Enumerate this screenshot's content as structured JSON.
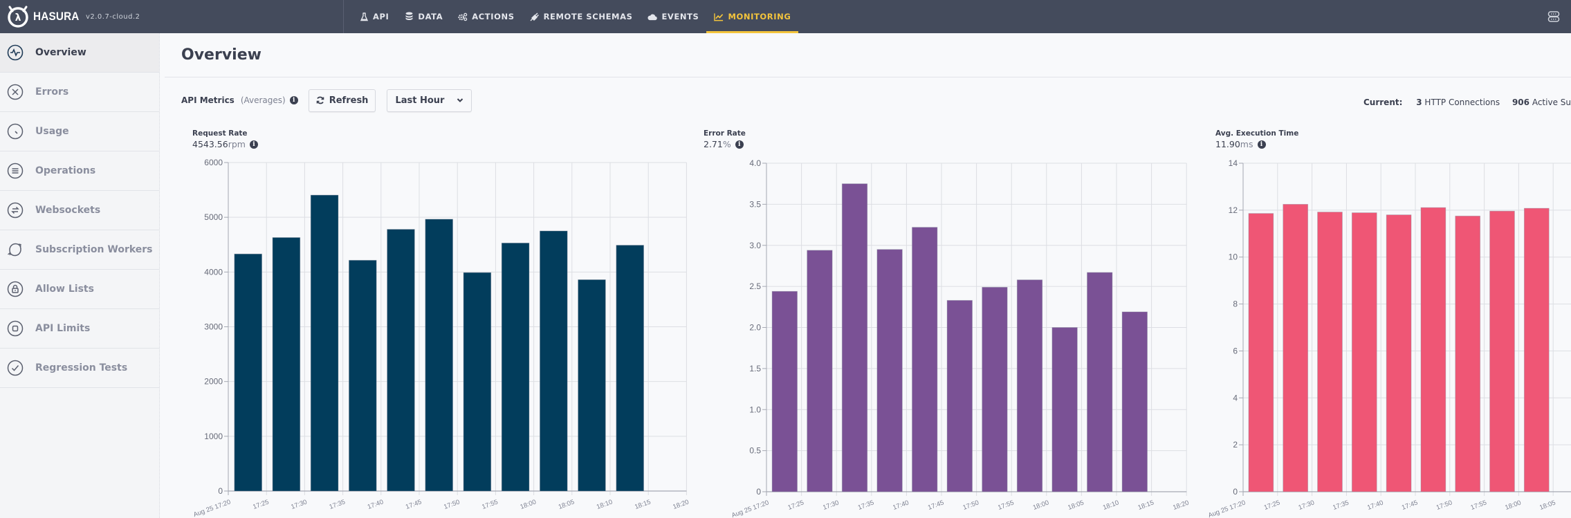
{
  "topbar": {
    "brand": "HASURA",
    "version": "v2.0.7-cloud.2",
    "nav": [
      {
        "label": "API",
        "icon": "flask-icon"
      },
      {
        "label": "DATA",
        "icon": "database-icon"
      },
      {
        "label": "ACTIONS",
        "icon": "cogs-icon"
      },
      {
        "label": "REMOTE SCHEMAS",
        "icon": "plug-icon"
      },
      {
        "label": "EVENTS",
        "icon": "cloud-icon"
      },
      {
        "label": "MONITORING",
        "icon": "line-chart-icon",
        "active": true
      }
    ],
    "right_icon": "server-icon"
  },
  "sidebar": {
    "items": [
      {
        "label": "Overview",
        "icon": "pulse-icon",
        "active": true
      },
      {
        "label": "Errors",
        "icon": "close-circle-icon"
      },
      {
        "label": "Usage",
        "icon": "clock-icon"
      },
      {
        "label": "Operations",
        "icon": "list-icon"
      },
      {
        "label": "Websockets",
        "icon": "exchange-icon"
      },
      {
        "label": "Subscription Workers",
        "icon": "refresh-icon"
      },
      {
        "label": "Allow Lists",
        "icon": "lock-icon"
      },
      {
        "label": "API Limits",
        "icon": "stop-icon"
      },
      {
        "label": "Regression Tests",
        "icon": "check-circle-icon"
      }
    ]
  },
  "main": {
    "title": "Overview",
    "metrics_label": "API Metrics",
    "metrics_sub": "(Averages)",
    "refresh_label": "Refresh",
    "range_label": "Last Hour",
    "current": {
      "label": "Current:",
      "http_count": "3",
      "http_label": "HTTP Connections",
      "subs_count": "906",
      "subs_label": "Active Subsc"
    }
  },
  "colors": {
    "topbar_bg": "#444b5c",
    "accent": "#f4c43c",
    "request_rate": "#023d5c",
    "error_rate": "#7a5195",
    "exec_time": "#ef5675"
  },
  "chart_data": [
    {
      "type": "bar",
      "title": "Request Rate",
      "summary_value": "4543.56",
      "summary_unit": "rpm",
      "xlabel": "",
      "ylabel": "",
      "categories": [
        "Aug 25 17:20",
        "17:25",
        "17:30",
        "17:35",
        "17:40",
        "17:45",
        "17:50",
        "17:55",
        "18:00",
        "18:05",
        "18:10",
        "18:15",
        "18:20"
      ],
      "values": [
        null,
        4330,
        4630,
        5405,
        4215,
        4780,
        4965,
        3990,
        4530,
        4750,
        3860,
        4490,
        null
      ],
      "ylim": [
        0,
        6000
      ],
      "yticks": [
        0,
        1000,
        2000,
        3000,
        4000,
        5000,
        6000
      ],
      "ytick_labels": [
        "0",
        "1000",
        "2000",
        "3000",
        "4000",
        "5000",
        "6000"
      ],
      "grid": true,
      "color": "#023d5c"
    },
    {
      "type": "bar",
      "title": "Error Rate",
      "summary_value": "2.71",
      "summary_unit": "%",
      "xlabel": "",
      "ylabel": "",
      "categories": [
        "Aug 25 17:20",
        "17:25",
        "17:30",
        "17:35",
        "17:40",
        "17:45",
        "17:50",
        "17:55",
        "18:00",
        "18:05",
        "18:10",
        "18:15",
        "18:20"
      ],
      "values": [
        null,
        2.44,
        2.94,
        3.75,
        2.95,
        3.22,
        2.33,
        2.49,
        2.58,
        2.0,
        2.67,
        2.19,
        null
      ],
      "ylim": [
        0,
        4.0
      ],
      "yticks": [
        0,
        0.5,
        1.0,
        1.5,
        2.0,
        2.5,
        3.0,
        3.5,
        4.0
      ],
      "ytick_labels": [
        "0",
        "0.5",
        "1.0",
        "1.5",
        "2.0",
        "2.5",
        "3.0",
        "3.5",
        "4.0"
      ],
      "grid": true,
      "color": "#7a5195"
    },
    {
      "type": "bar",
      "title": "Avg. Execution Time",
      "summary_value": "11.90",
      "summary_unit": "ms",
      "xlabel": "",
      "ylabel": "",
      "categories": [
        "Aug 25 17:20",
        "17:25",
        "17:30",
        "17:35",
        "17:40",
        "17:45",
        "17:50",
        "17:55",
        "18:00",
        "18:05"
      ],
      "values": [
        null,
        11.86,
        12.25,
        11.92,
        11.89,
        11.8,
        12.11,
        11.75,
        11.96,
        12.08
      ],
      "ylim": [
        0,
        14
      ],
      "yticks": [
        0,
        2,
        4,
        6,
        8,
        10,
        12,
        14
      ],
      "ytick_labels": [
        "0",
        "2",
        "4",
        "6",
        "8",
        "10",
        "12",
        "14"
      ],
      "grid": true,
      "color": "#ef5675"
    }
  ]
}
